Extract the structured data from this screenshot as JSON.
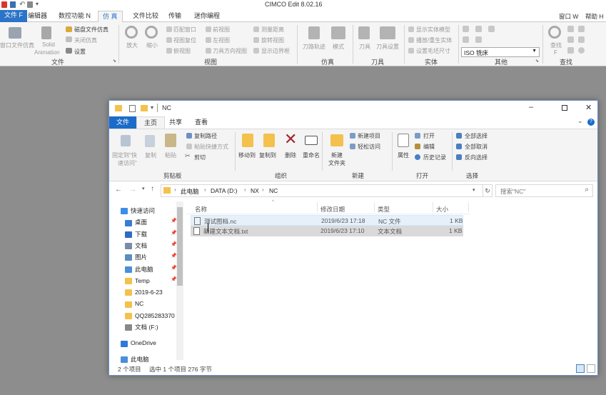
{
  "cimco": {
    "title": "CIMCO Edit 8.02.16",
    "tabs": [
      "文件 F",
      "编辑器",
      "数控功能 N",
      "仿 真",
      "文件比较",
      "传输",
      "迷你编程"
    ],
    "active_tab": "仿 真",
    "user": "窗口 W",
    "help": "帮助 H",
    "ribbon": {
      "window_sim": "窗口文件仿真",
      "solid_anim_1": "Solid",
      "solid_anim_2": "Animation",
      "disk_sim": "磁盘文件仿真",
      "close_sim": "关闭仿真",
      "settings": "设置",
      "group_file": "文件",
      "zoom_in": "放大",
      "zoom_out": "缩小",
      "fit_window": "匹配窗口",
      "view_reset": "视图复位",
      "top_view": "俯视图",
      "front_view": "前视图",
      "left_view": "左视图",
      "tool_dir_view": "刀具方向视图",
      "measure": "测量距离",
      "rotate_view": "旋转视图",
      "show_bounds": "显示边界框",
      "group_view": "视图",
      "toolpath": "刀路轨迹",
      "mode": "模式",
      "group_sim": "仿真",
      "tool": "刀具",
      "tool_setup": "刀具设置",
      "group_tool": "刀具",
      "show_solid": "显示实体模型",
      "reset_solid": "播放/重生实体",
      "blank_size": "设置毛坯尺寸",
      "group_solid": "实体",
      "iso_select": "ISO 铣床",
      "group_other": "其他",
      "find": "查找",
      "find_f": "F",
      "group_find": "查找"
    }
  },
  "explorer": {
    "title": "NC",
    "tabs": [
      "文件",
      "主页",
      "共享",
      "查看"
    ],
    "active_tab": "主页",
    "ribbon": {
      "pin_quick_1": "固定到\"快",
      "pin_quick_2": "速访问\"",
      "copy": "复制",
      "paste": "粘贴",
      "copy_path": "复制路径",
      "paste_shortcut": "粘贴快捷方式",
      "cut": "剪切",
      "group_clipboard": "剪贴板",
      "move_to": "移动到",
      "copy_to": "复制到",
      "delete": "删除",
      "rename": "重命名",
      "group_organize": "组织",
      "new_folder_1": "新建",
      "new_folder_2": "文件夹",
      "new_item": "新建项目",
      "easy_access": "轻松访问",
      "group_new": "新建",
      "properties": "属性",
      "open": "打开",
      "edit": "编辑",
      "history": "历史记录",
      "group_open": "打开",
      "select_all": "全部选择",
      "select_none": "全部取消",
      "invert_select": "反向选择",
      "group_select": "选择"
    },
    "address": {
      "crumbs": [
        "此电脑",
        "DATA (D:)",
        "NX",
        "NC"
      ],
      "search_placeholder": "搜索\"NC\""
    },
    "nav": [
      {
        "label": "快速访问",
        "color": "#3d8ee6",
        "pinned": false,
        "indent": 0
      },
      {
        "label": "桌面",
        "color": "#3a7bd5",
        "pinned": true,
        "indent": 1
      },
      {
        "label": "下载",
        "color": "#2e6bc5",
        "pinned": true,
        "indent": 1
      },
      {
        "label": "文档",
        "color": "#7a8aa8",
        "pinned": true,
        "indent": 1
      },
      {
        "label": "图片",
        "color": "#5a8dc0",
        "pinned": true,
        "indent": 1
      },
      {
        "label": "此电脑",
        "color": "#4a8fd8",
        "pinned": true,
        "indent": 1
      },
      {
        "label": "Temp",
        "color": "#f3c14c",
        "pinned": true,
        "indent": 1
      },
      {
        "label": "2019-6-23",
        "color": "#f3c14c",
        "pinned": false,
        "indent": 1
      },
      {
        "label": "NC",
        "color": "#f3c14c",
        "pinned": false,
        "indent": 1
      },
      {
        "label": "QQ285283370（",
        "color": "#f3c14c",
        "pinned": false,
        "indent": 1
      },
      {
        "label": "文档 (F:)",
        "color": "#888888",
        "pinned": false,
        "indent": 1
      },
      {
        "label": "OneDrive",
        "color": "#2f7ad9",
        "pinned": false,
        "indent": 0
      },
      {
        "label": "此电脑",
        "color": "#4a8fd8",
        "pinned": false,
        "indent": 0
      }
    ],
    "columns": [
      "名称",
      "修改日期",
      "类型",
      "大小"
    ],
    "files": [
      {
        "name": "测试图档.nc",
        "date": "2019/6/23 17:18",
        "type": "NC 文件",
        "size": "1 KB",
        "selected": true
      },
      {
        "name": "新建文本文档.txt",
        "date": "2019/6/23 17:10",
        "type": "文本文档",
        "size": "1 KB",
        "selected": false
      }
    ],
    "status": {
      "count": "2 个项目",
      "selection": "选中 1 个项目  276 字节"
    }
  }
}
